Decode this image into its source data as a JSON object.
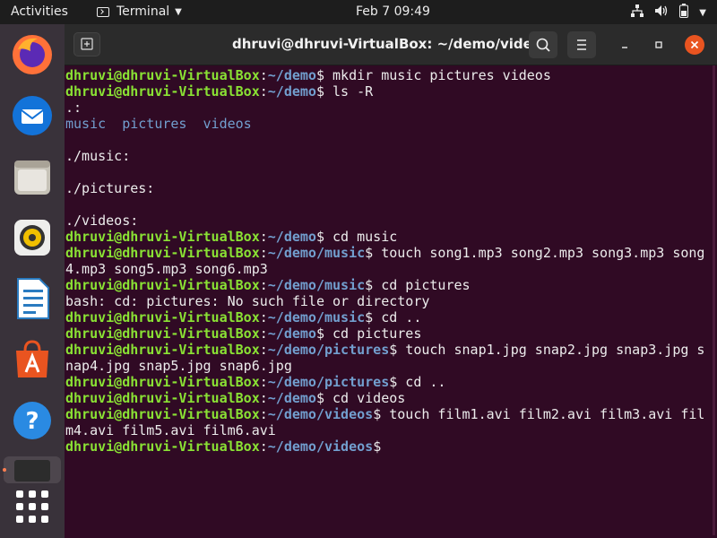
{
  "topbar": {
    "activities": "Activities",
    "app_name": "Terminal",
    "clock": "Feb 7  09:49"
  },
  "window": {
    "title": "dhruvi@dhruvi-VirtualBox: ~/demo/videos"
  },
  "terminal": {
    "lines": [
      {
        "user": "dhruvi@dhruvi-VirtualBox",
        "sep": ":",
        "path": "~/demo",
        "cmd": "$ mkdir music pictures videos"
      },
      {
        "user": "dhruvi@dhruvi-VirtualBox",
        "sep": ":",
        "path": "~/demo",
        "cmd": "$ ls -R"
      },
      {
        "text": ".:"
      },
      {
        "dirs": [
          "music",
          "pictures",
          "videos"
        ]
      },
      {
        "text": ""
      },
      {
        "text": "./music:"
      },
      {
        "text": ""
      },
      {
        "text": "./pictures:"
      },
      {
        "text": ""
      },
      {
        "text": "./videos:"
      },
      {
        "user": "dhruvi@dhruvi-VirtualBox",
        "sep": ":",
        "path": "~/demo",
        "cmd": "$ cd music"
      },
      {
        "user": "dhruvi@dhruvi-VirtualBox",
        "sep": ":",
        "path": "~/demo/music",
        "cmd": "$ touch song1.mp3 song2.mp3 song3.mp3 song"
      },
      {
        "text": "4.mp3 song5.mp3 song6.mp3"
      },
      {
        "user": "dhruvi@dhruvi-VirtualBox",
        "sep": ":",
        "path": "~/demo/music",
        "cmd": "$ cd pictures"
      },
      {
        "text": "bash: cd: pictures: No such file or directory"
      },
      {
        "user": "dhruvi@dhruvi-VirtualBox",
        "sep": ":",
        "path": "~/demo/music",
        "cmd": "$ cd .."
      },
      {
        "user": "dhruvi@dhruvi-VirtualBox",
        "sep": ":",
        "path": "~/demo",
        "cmd": "$ cd pictures"
      },
      {
        "user": "dhruvi@dhruvi-VirtualBox",
        "sep": ":",
        "path": "~/demo/pictures",
        "cmd": "$ touch snap1.jpg snap2.jpg snap3.jpg s"
      },
      {
        "text": "nap4.jpg snap5.jpg snap6.jpg"
      },
      {
        "user": "dhruvi@dhruvi-VirtualBox",
        "sep": ":",
        "path": "~/demo/pictures",
        "cmd": "$ cd .."
      },
      {
        "user": "dhruvi@dhruvi-VirtualBox",
        "sep": ":",
        "path": "~/demo",
        "cmd": "$ cd videos"
      },
      {
        "user": "dhruvi@dhruvi-VirtualBox",
        "sep": ":",
        "path": "~/demo/videos",
        "cmd": "$ touch film1.avi film2.avi film3.avi fil"
      },
      {
        "text": "m4.avi film5.avi film6.avi"
      },
      {
        "user": "dhruvi@dhruvi-VirtualBox",
        "sep": ":",
        "path": "~/demo/videos",
        "cmd": "$"
      }
    ]
  },
  "dock": {
    "apps": [
      "firefox-icon",
      "thunderbird-icon",
      "files-icon",
      "rhythmbox-icon",
      "writer-icon",
      "software-icon",
      "help-icon",
      "terminal-icon"
    ]
  },
  "colors": {
    "terminal_bg": "#300a24",
    "prompt_user": "#8ae234",
    "prompt_path": "#729fcf",
    "accent": "#e95420"
  }
}
